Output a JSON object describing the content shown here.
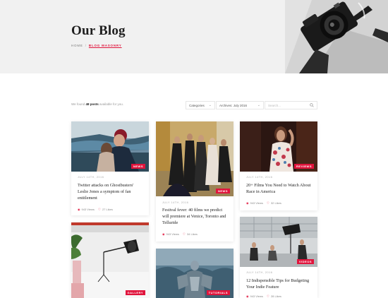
{
  "hero": {
    "title": "Our Blog",
    "breadcrumb": {
      "home": "Home",
      "separator": "/",
      "current": "Blog Masonry"
    }
  },
  "filter": {
    "text_prefix": "We found",
    "count": "48 posts",
    "text_suffix": "available for you.",
    "categories_label": "Categories",
    "archives_label": "Archives: July 2016",
    "search_placeholder": "Search..."
  },
  "posts": [
    {
      "date": "July 14th, 2016",
      "badge": "News",
      "title": "Twitter attacks on Ghostbusters' Leslie Jones a symptom of fan entitlement",
      "views": "943 Views",
      "likes": "27 Likes"
    },
    {
      "date": "July 14th, 2016",
      "badge": "News",
      "title": "Festival fever: 40 films we predict will premiere at Venice, Toronto and Telluride",
      "views": "943 Views",
      "likes": "34 Likes"
    },
    {
      "date": "July 14th, 2016",
      "badge": "Reviews",
      "title": "20+ Films You Need to Watch About Race in America",
      "views": "943 Views",
      "likes": "32 Likes"
    },
    {
      "badge": "Gallery"
    },
    {
      "badge": "Tutorials"
    },
    {
      "date": "July 14th, 2016",
      "badge": "Videos",
      "title": "12 Indispensible Tips for Budgeting Your Indie Feature",
      "views": "943 Views",
      "likes": "28 Likes"
    }
  ],
  "colors": {
    "accent": "#e0143c",
    "hero_bg": "#f1f1f1",
    "text_dark": "#1e1e1e"
  },
  "icons": {
    "views": "eye-icon",
    "likes": "heart-icon",
    "search": "search-icon",
    "dropdown": "chevron-down-icon"
  }
}
